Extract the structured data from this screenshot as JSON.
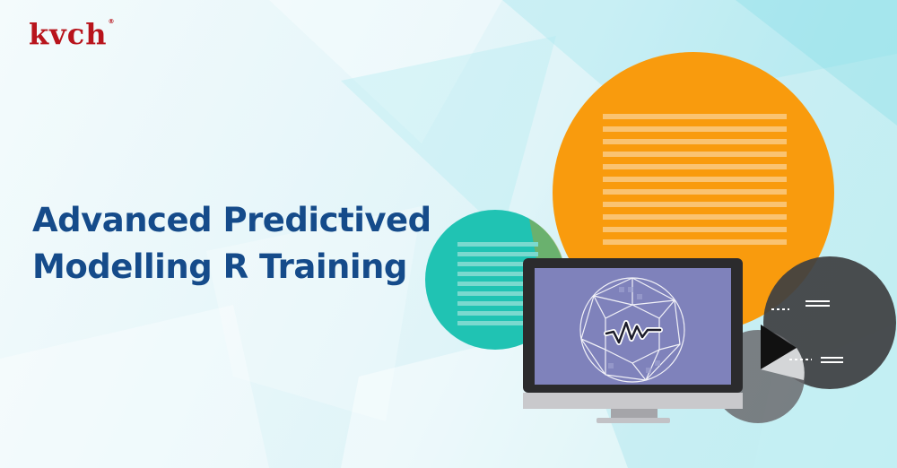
{
  "brand": {
    "logo_text": "kvch",
    "registered_mark": "®"
  },
  "headline": {
    "line1": "Advanced Predictived",
    "line2": "Modelling R Training"
  },
  "colors": {
    "brand_red": "#b8141c",
    "headline_blue": "#154b8a",
    "orange": "#f99b0d",
    "teal": "#20c3b3",
    "dark_gray": "#3e3f42",
    "monitor_screen": "#7f82bb"
  },
  "icons": {
    "monitor": "monitor-icon",
    "waveform": "waveform-icon",
    "pie": "pie-chart-icon"
  }
}
